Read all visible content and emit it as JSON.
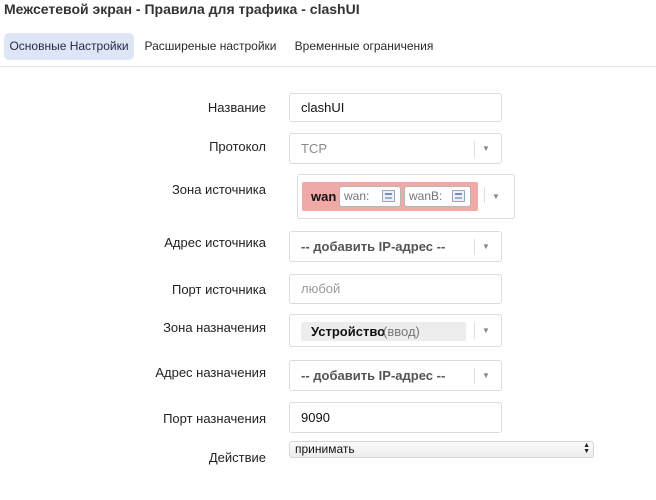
{
  "window": {
    "title": "Межсетевой экран - Правила для трафика - clashUI"
  },
  "tabs": [
    {
      "label": "Основные Настройки",
      "active": true
    },
    {
      "label": "Расширеные настройки",
      "active": false
    },
    {
      "label": "Временные ограничения",
      "active": false
    }
  ],
  "form": {
    "name": {
      "label": "Название",
      "value": "clashUI"
    },
    "protocol": {
      "label": "Протокол",
      "value": "TCP"
    },
    "source_zone": {
      "label": "Зона источника",
      "zone": "wan",
      "color": "#f1a9a7",
      "interfaces": [
        "wan:",
        "wanB:"
      ]
    },
    "source_address": {
      "label": "Адрес источника",
      "value": "-- добавить IP-адрес --"
    },
    "source_port": {
      "label": "Порт источника",
      "placeholder": "любой"
    },
    "dest_zone": {
      "label": "Зона назначения",
      "value": "Устройство",
      "suffix": "(ввод)"
    },
    "dest_address": {
      "label": "Адрес назначения",
      "value": "-- добавить IP-адрес --"
    },
    "dest_port": {
      "label": "Порт назначения",
      "value": "9090"
    },
    "action": {
      "label": "Действие",
      "value": "принимать"
    }
  },
  "colors": {
    "active_tab": "#dde5f7",
    "zone_wan": "#f1a9a7"
  }
}
